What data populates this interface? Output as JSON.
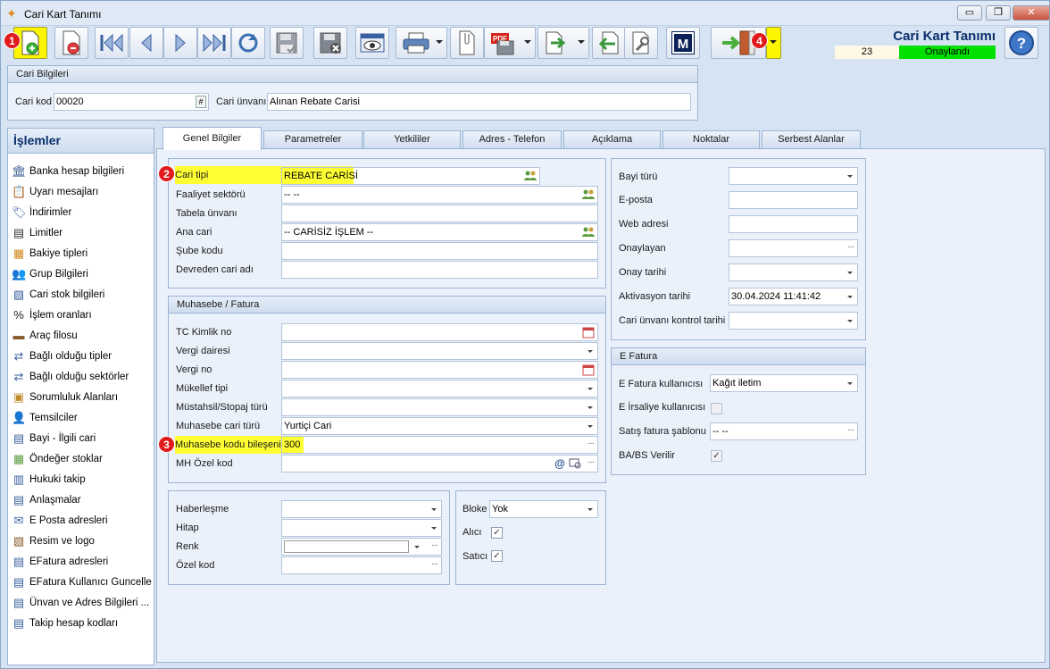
{
  "window": {
    "title": "Cari Kart Tanımı",
    "minimize": "▭",
    "restore": "❐",
    "close": "✕"
  },
  "toolbar": {
    "buttons": [
      "new-doc-icon",
      "delete-doc-icon",
      "first-icon",
      "prev-icon",
      "next-icon",
      "last-icon",
      "refresh-icon",
      "save-icon",
      "cancel-save-icon",
      "preview-icon",
      "print-icon",
      "attach-icon",
      "pdf-icon",
      "export-icon",
      "import-icon",
      "settings-icon",
      "m-icon",
      "exit-icon",
      "help-icon"
    ],
    "m_label": "M",
    "pdf_label": "PDF"
  },
  "header": {
    "title": "Cari Kart Tanımı",
    "record_no": "23",
    "status": "Onaylandı",
    "status_color": "#00e000"
  },
  "badges": [
    "1",
    "2",
    "3",
    "4"
  ],
  "cari_bilgileri": {
    "title": "Cari Bilgileri",
    "kod_label": "Cari kod",
    "kod_value": "00020",
    "kod_btn": "#",
    "unvan_label": "Cari ünvanı",
    "unvan_value": "Alınan Rebate Carisi"
  },
  "islemler": {
    "title": "İşlemler",
    "items": [
      "Banka hesap bilgileri",
      "Uyarı mesajları",
      "İndirimler",
      "Limitler",
      "Bakiye tipleri",
      "Grup Bilgileri",
      "Cari stok bilgileri",
      "İşlem oranları",
      "Araç filosu",
      "Bağlı olduğu tipler",
      "Bağlı olduğu sektörler",
      "Sorumluluk Alanları",
      "Temsilciler",
      "Bayi - İlgili cari",
      "Öndeğer stoklar",
      "Hukuki takip",
      "Anlaşmalar",
      "E Posta adresleri",
      "Resim ve logo",
      "EFatura adresleri",
      "EFatura Kullanıcı Guncelle",
      "Ünvan ve Adres Bilgileri ...",
      "Takip hesap kodları"
    ]
  },
  "tabs": [
    "Genel Bilgiler",
    "Parametreler",
    "Yetkililer",
    "Adres - Telefon",
    "Açıklama",
    "Noktalar",
    "Serbest Alanlar"
  ],
  "genel": {
    "cari_tipi_label": "Cari tipi",
    "cari_tipi_value": "REBATE CARİSİ",
    "faaliyet_label": "Faaliyet sektörü",
    "faaliyet_value": "-- --",
    "tabela_label": "Tabela ünvanı",
    "tabela_value": "",
    "ana_cari_label": "Ana cari",
    "ana_cari_value": "-- CARİSİZ İŞLEM --",
    "sube_label": "Şube kodu",
    "sube_value": "",
    "devreden_label": "Devreden cari adı",
    "devreden_value": ""
  },
  "muhasebe": {
    "title": "Muhasebe / Fatura",
    "tc_label": "TC Kimlik no",
    "tc_value": "",
    "vergi_dairesi_label": "Vergi dairesi",
    "vergi_dairesi_value": "",
    "vergi_no_label": "Vergi no",
    "vergi_no_value": "",
    "mukellef_label": "Mükellef tipi",
    "mukellef_value": "",
    "mustahsil_label": "Müstahsil/Stopaj türü",
    "mustahsil_value": "",
    "muh_cari_turu_label": "Muhasebe cari türü",
    "muh_cari_turu_value": "Yurtiçi Cari",
    "muh_kodu_label": "Muhasebe kodu bileşeni",
    "muh_kodu_value": "300",
    "mh_ozel_label": "MH Özel kod",
    "mh_ozel_value": ""
  },
  "diger": {
    "haberlesme_label": "Haberleşme",
    "haberlesme_value": "",
    "hitap_label": "Hitap",
    "hitap_value": "",
    "renk_label": "Renk",
    "renk_value": "",
    "ozel_kod_label": "Özel kod",
    "ozel_kod_value": ""
  },
  "bloke": {
    "bloke_label": "Bloke",
    "bloke_value": "Yok",
    "alici_label": "Alıcı",
    "alici_checked": true,
    "satici_label": "Satıcı",
    "satici_checked": true
  },
  "bayi": {
    "bayi_turu_label": "Bayi türü",
    "bayi_turu_value": "",
    "eposta_label": "E-posta",
    "eposta_value": "",
    "web_label": "Web adresi",
    "web_value": "",
    "onaylayan_label": "Onaylayan",
    "onaylayan_value": "",
    "onay_tarihi_label": "Onay tarihi",
    "onay_tarihi_value": "",
    "aktivasyon_label": "Aktivasyon tarihi",
    "aktivasyon_value": "30.04.2024 11:41:42",
    "unvan_kontrol_label": "Cari ünvanı kontrol tarihi",
    "unvan_kontrol_value": ""
  },
  "efatura": {
    "title": "E Fatura",
    "kullanici_label": "E Fatura kullanıcısı",
    "kullanici_value": "Kağıt iletim",
    "irsaliye_label": "E İrsaliye kullanıcısı",
    "irsaliye_checked": false,
    "sablon_label": "Satış fatura şablonu",
    "sablon_value": "-- --",
    "babs_label": "BA/BS Verilir",
    "babs_checked": true
  },
  "colors": {
    "highlight": "#ffff33",
    "badge": "#e11b1b",
    "title": "#0b2f6b"
  }
}
